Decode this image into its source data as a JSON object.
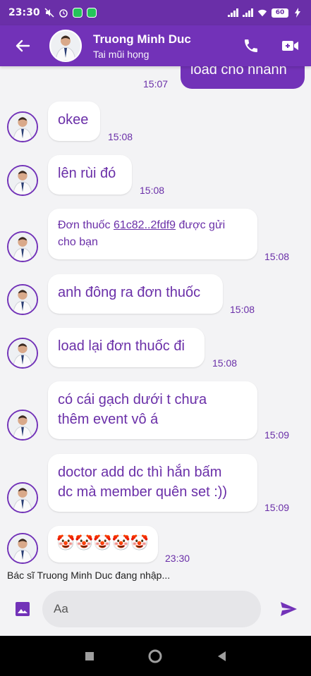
{
  "status_bar": {
    "time": "23:30",
    "battery": "60"
  },
  "header": {
    "name": "Truong Minh Duc",
    "subtitle": "Tai mũi họng"
  },
  "outgoing": {
    "text": "load cho nhanh",
    "time": "15:07"
  },
  "messages": [
    {
      "text": "okee",
      "time": "15:08"
    },
    {
      "text": "lên rùi đó",
      "time": "15:08"
    },
    {
      "text_prefix": "Đơn thuốc ",
      "link": "61c82..2fdf9",
      "text_suffix_1": " được gửi",
      "text_suffix_2": "cho bạn",
      "time": "15:08"
    },
    {
      "text": "anh đông ra đơn thuốc",
      "time": "15:08"
    },
    {
      "text": "load lại đơn thuốc đi",
      "time": "15:08"
    },
    {
      "line1": "có cái gạch dưới t chưa",
      "line2": "thêm event vô á",
      "time": "15:09"
    },
    {
      "line1": "doctor add dc thì hắn bấm",
      "line2": "dc mà member quên set :))",
      "time": "15:09"
    },
    {
      "text": "🤡🤡🤡🤡🤡",
      "time": "23:30"
    }
  ],
  "typing_indicator": "Bác sĩ Truong Minh Duc đang nhập...",
  "composer": {
    "placeholder": "Aa"
  },
  "colors": {
    "primary": "#7232b8",
    "status_bar": "#6a2fa8",
    "bubble_text": "#6a2fa8"
  }
}
